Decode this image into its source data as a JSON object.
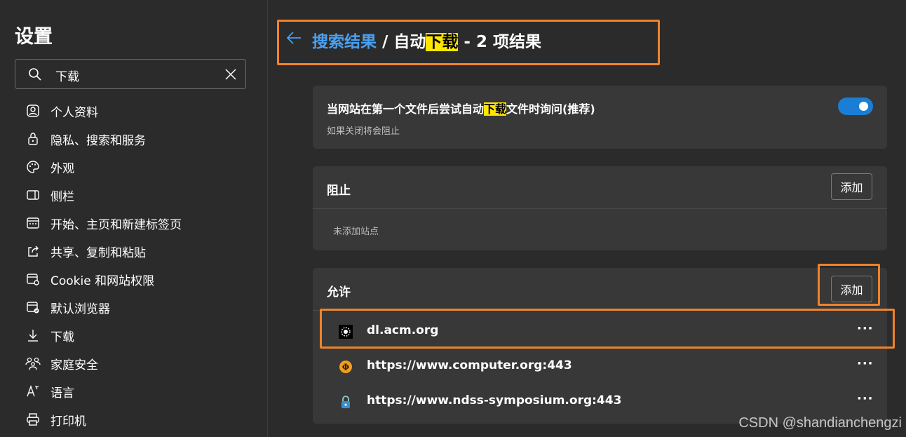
{
  "sidebar": {
    "title": "设置",
    "search": {
      "value": "下载",
      "icon": "search-icon",
      "clear_icon": "close-icon"
    },
    "items": [
      {
        "label": "个人资料",
        "icon": "profile-icon"
      },
      {
        "label": "隐私、搜索和服务",
        "icon": "lock-icon"
      },
      {
        "label": "外观",
        "icon": "palette-icon"
      },
      {
        "label": "侧栏",
        "icon": "sidebar-icon"
      },
      {
        "label": "开始、主页和新建标签页",
        "icon": "home-tab-icon"
      },
      {
        "label": "共享、复制和粘贴",
        "icon": "share-icon"
      },
      {
        "label": "Cookie 和网站权限",
        "icon": "site-permissions-icon"
      },
      {
        "label": "默认浏览器",
        "icon": "browser-icon"
      },
      {
        "label": "下载",
        "icon": "download-icon"
      },
      {
        "label": "家庭安全",
        "icon": "family-icon"
      },
      {
        "label": "语言",
        "icon": "language-icon"
      },
      {
        "label": "打印机",
        "icon": "printer-icon"
      }
    ]
  },
  "header": {
    "link": "搜索结果",
    "sep": " / ",
    "pre": "自动",
    "highlight": "下载",
    "post": " - 2 项结果"
  },
  "prompt_card": {
    "title_pre": "当网站在第一个文件后尝试自动",
    "title_highlight": "下载",
    "title_post": "文件时询问(推荐)",
    "subtitle": "如果关闭将会阻止",
    "toggle_on": true
  },
  "block_card": {
    "title": "阻止",
    "add_label": "添加",
    "empty": "未添加站点"
  },
  "allow_card": {
    "title": "允许",
    "add_label": "添加",
    "sites": [
      {
        "name": "dl.acm.org",
        "more": "···"
      },
      {
        "name": "https://www.computer.org:443",
        "more": "···"
      },
      {
        "name": "https://www.ndss-symposium.org:443",
        "more": "···"
      }
    ]
  },
  "watermark": "CSDN @shandianchengzi",
  "colors": {
    "accent": "#1a7fd4",
    "link": "#4aa0f0",
    "highlight": "#ffe600",
    "annotation": "#f0832a"
  }
}
